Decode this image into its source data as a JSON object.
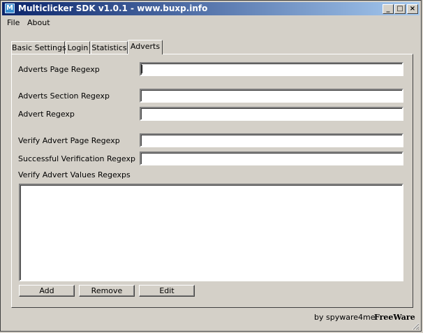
{
  "window": {
    "title": "Multiclicker SDK v1.0.1 - www.buxp.info"
  },
  "titlebar_buttons": {
    "minimize": "_",
    "maximize": "□",
    "close": "×"
  },
  "menu": [
    "File",
    "About"
  ],
  "tabs": [
    {
      "label": "Basic Settings",
      "active": false
    },
    {
      "label": "Login",
      "active": false
    },
    {
      "label": "Statistics",
      "active": false
    },
    {
      "label": "Adverts",
      "active": true
    }
  ],
  "fields": {
    "adverts_page_regexp": {
      "label": "Adverts Page Regexp",
      "value": ""
    },
    "adverts_section_regexp": {
      "label": "Adverts Section Regexp",
      "value": ""
    },
    "advert_regexp": {
      "label": "Advert Regexp",
      "value": ""
    },
    "verify_advert_page_regexp": {
      "label": "Verify Advert Page Regexp",
      "value": ""
    },
    "successful_verification_regexp": {
      "label": "Successful Verification Regexp",
      "value": ""
    }
  },
  "values_list": {
    "label": "Verify Advert Values Regexps",
    "items": []
  },
  "buttons": {
    "add": "Add",
    "remove": "Remove",
    "edit": "Edit"
  },
  "footer": {
    "credit": "by spyware4me",
    "license": "FreeWare"
  }
}
